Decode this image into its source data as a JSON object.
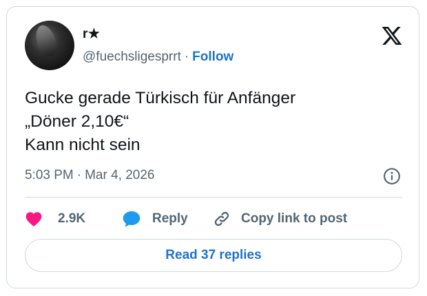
{
  "author": {
    "name": "r★",
    "handle": "@fuechsligesprrt",
    "separator": "·",
    "follow_label": "Follow"
  },
  "tweet": {
    "lines": [
      "Gucke gerade Türkisch für Anfänger",
      "„Döner 2,10€“",
      "Kann nicht sein"
    ],
    "time": "5:03 PM",
    "date": "Mar 4, 2026",
    "meta_separator": "·"
  },
  "actions": {
    "like_count": "2.9K",
    "reply_label": "Reply",
    "copy_label": "Copy link to post"
  },
  "read_replies_label": "Read 37 replies",
  "colors": {
    "heart": "#f91880",
    "reply": "#1d9bf0",
    "link_blue": "#1d73c8",
    "muted": "#536471",
    "border": "#cfd9de",
    "text": "#0f1419"
  },
  "icons": [
    "x-logo-icon",
    "info-icon",
    "heart-icon",
    "reply-bubble-icon",
    "link-icon"
  ]
}
